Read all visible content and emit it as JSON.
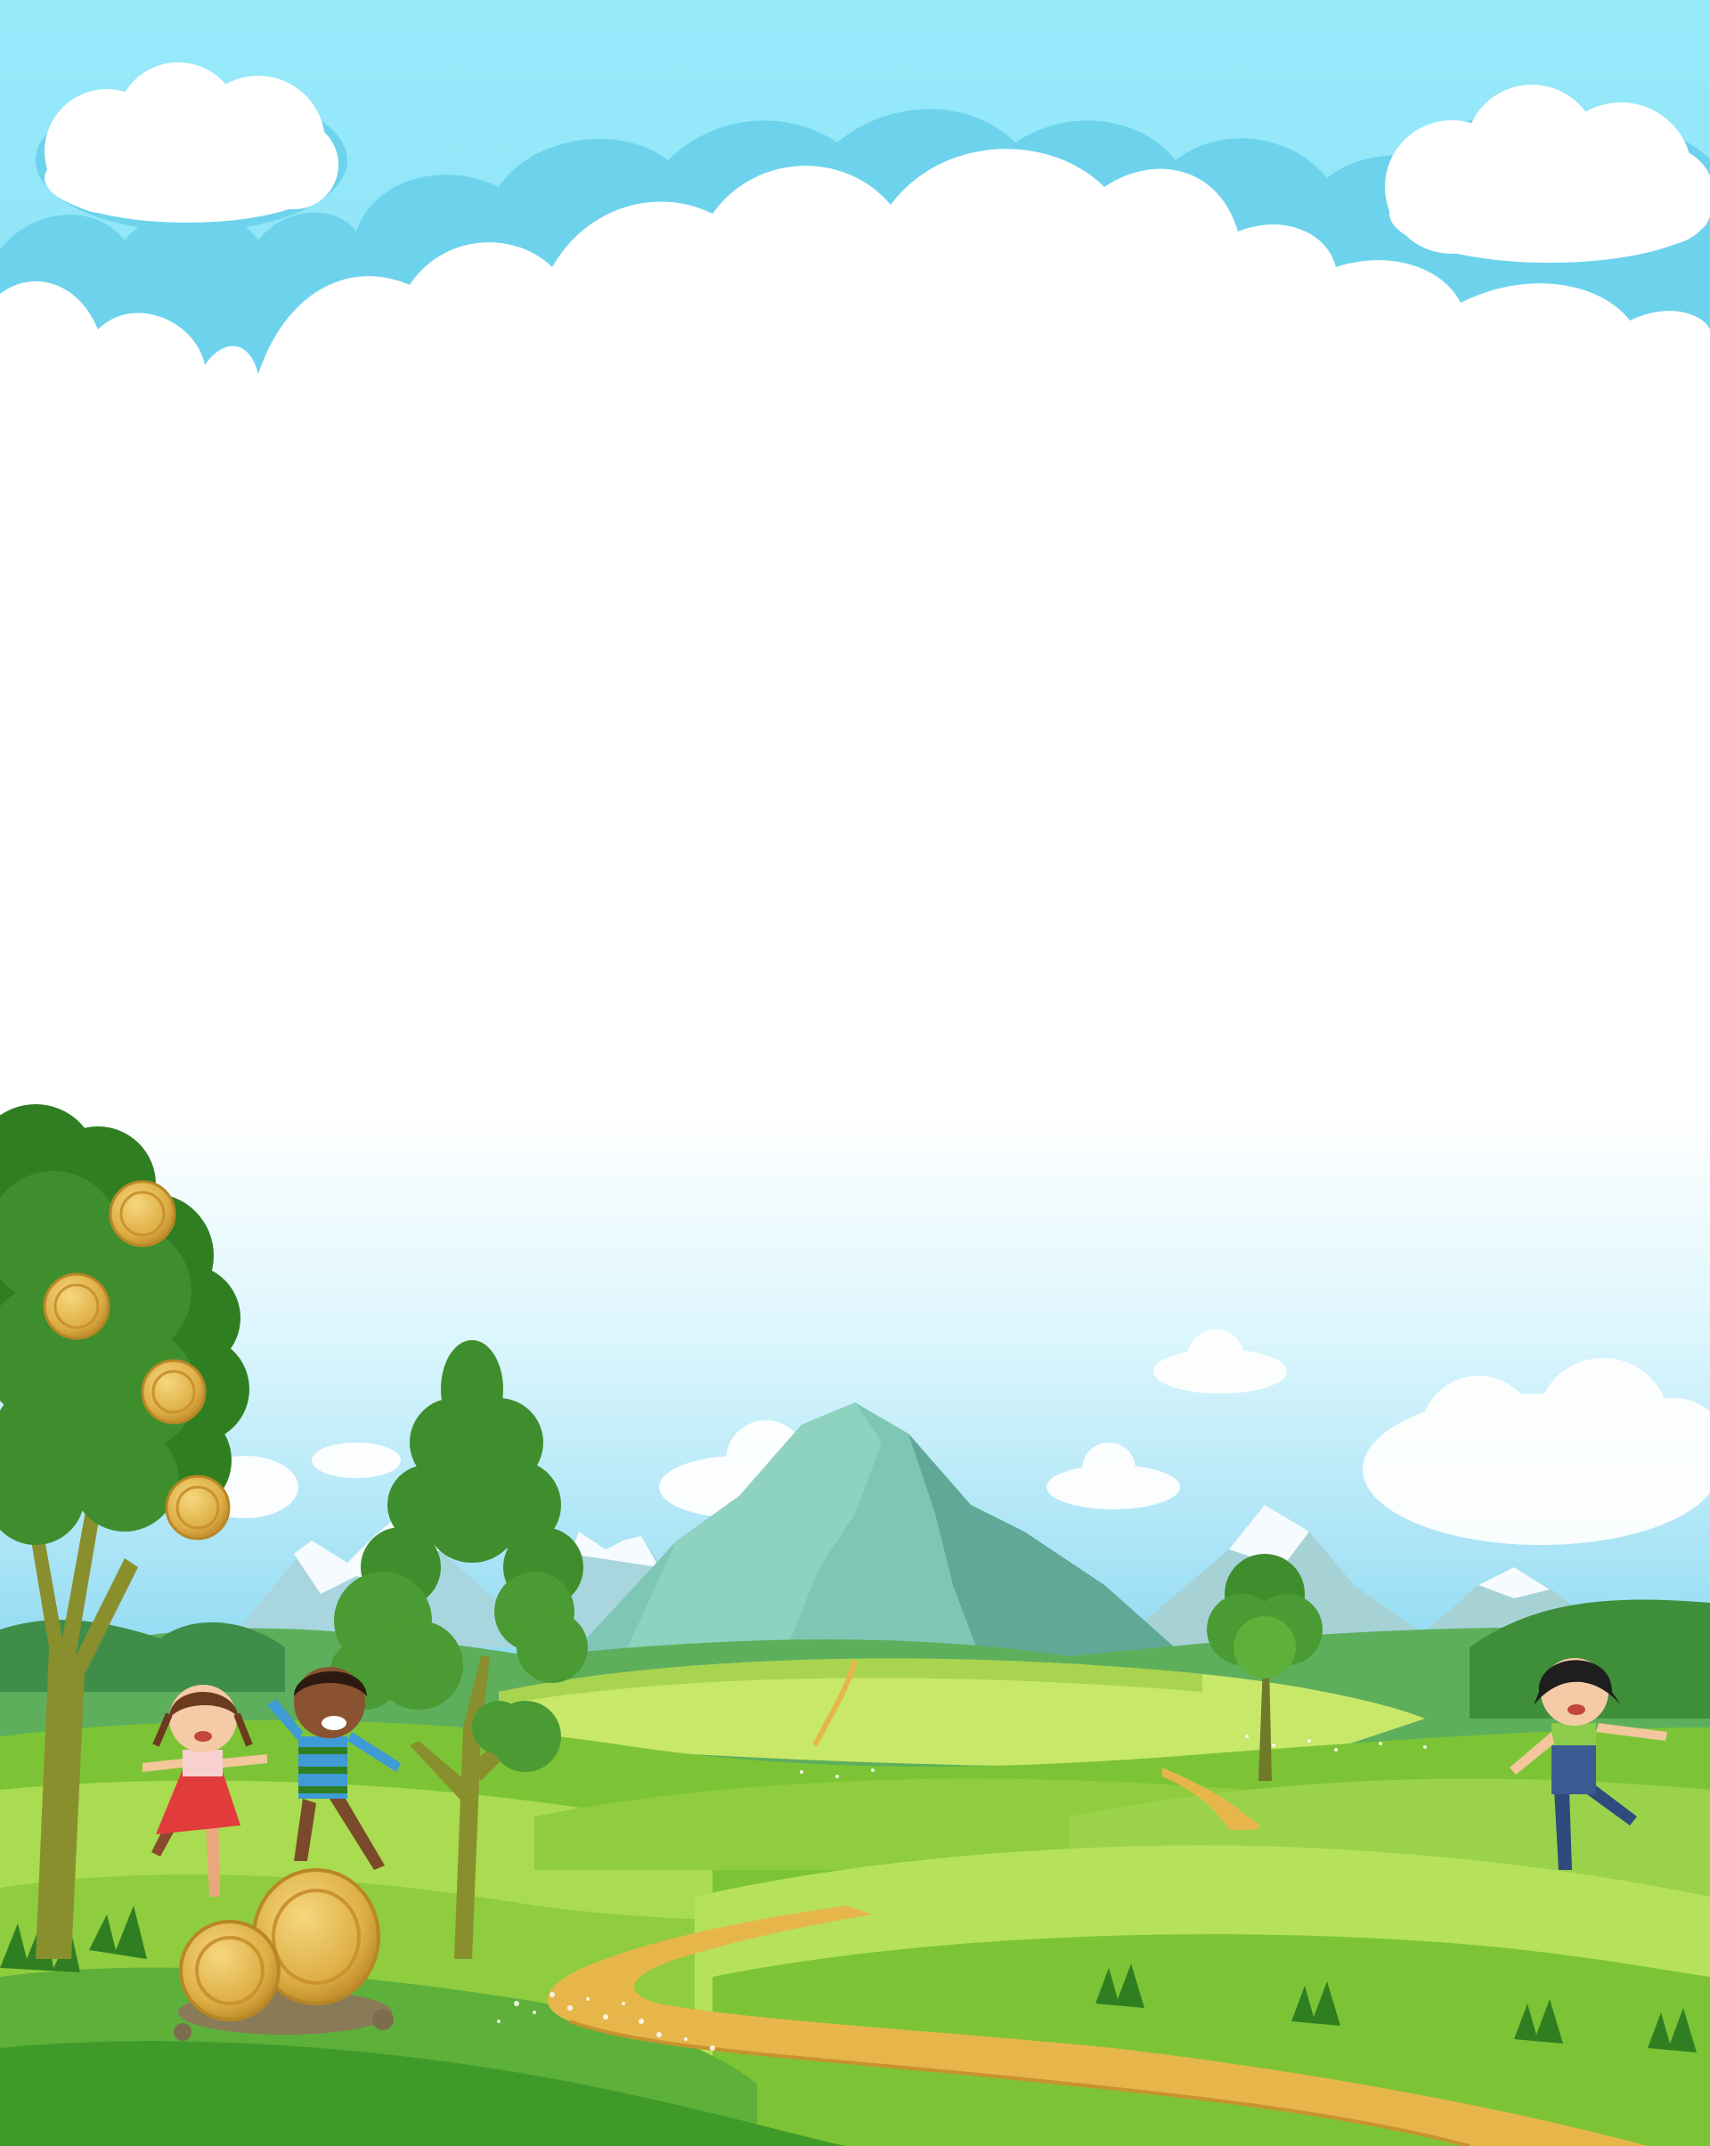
{
  "scene": {
    "kind": "illustration",
    "palette": {
      "sky_top": "#96EAFA",
      "sky_mid": "#6DD3EC",
      "cloud": "#FFFFFF",
      "mountain": "#7FC7B5",
      "mountain_dark": "#5FA996",
      "snow": "#F5FBFF",
      "grass_light": "#B5E25A",
      "grass": "#7CC436",
      "grass_dark": "#3F9A2A",
      "field_yellow": "#C8E86A",
      "path": "#E7B64A",
      "tree_foliage": "#3E8E2D",
      "tree_foliage_light": "#5DB13A",
      "tree_trunk": "#8A8F2D",
      "coin": "#E2B34A",
      "coin_dark": "#B98626"
    },
    "elements": [
      "cloud-border",
      "mountains",
      "hills",
      "path",
      "money-tree",
      "coins",
      "kids-playing",
      "trees",
      "meadow-flowers"
    ]
  }
}
